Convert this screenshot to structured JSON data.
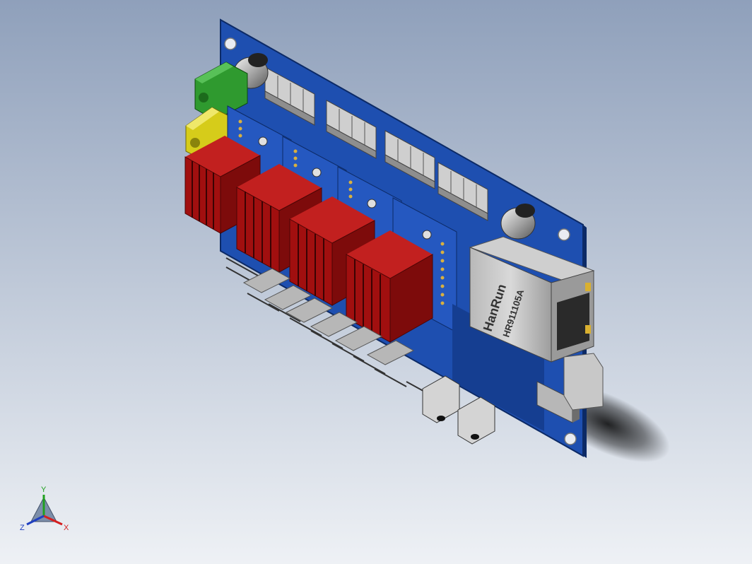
{
  "viewport": {
    "background_top": "#8fa0bb",
    "background_bottom": "#eef1f5"
  },
  "model": {
    "pcb_color": "#1e4fb0",
    "heatsink_color": "#a10f0f",
    "heatsink_dark": "#5e0606",
    "connector_color": "#c9c9c9",
    "terminal_green": "#2f9a2f",
    "terminal_yellow": "#d6cc1a",
    "ethernet_jack": {
      "brand": "HanRun",
      "part": "HR911105A"
    }
  },
  "triad": {
    "x_label": "X",
    "y_label": "Y",
    "z_label": "Z",
    "x_color": "#d42020",
    "y_color": "#20a020",
    "z_color": "#2040c0"
  }
}
